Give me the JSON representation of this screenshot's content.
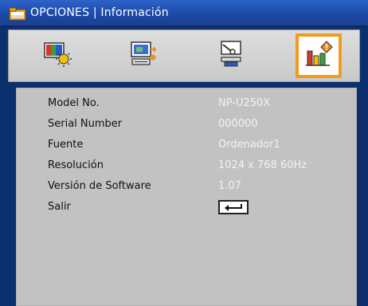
{
  "header": {
    "title": "OPCIONES | Información",
    "icon": "options-folder-icon"
  },
  "tabs": [
    {
      "name": "tab-image",
      "icon": "image-settings-icon",
      "selected": false
    },
    {
      "name": "tab-display",
      "icon": "screen-settings-icon",
      "selected": false
    },
    {
      "name": "tab-setup",
      "icon": "setup-tools-icon",
      "selected": false
    },
    {
      "name": "tab-information",
      "icon": "information-chart-icon",
      "selected": true
    }
  ],
  "info": {
    "rows": [
      {
        "label": "Model No.",
        "value": "NP-U250X"
      },
      {
        "label": "Serial Number",
        "value": "000000"
      },
      {
        "label": "Fuente",
        "value": "Ordenador1"
      },
      {
        "label": "Resolución",
        "value": "1024 x 768  60Hz"
      },
      {
        "label": "Versión de Software",
        "value": "1.07"
      }
    ],
    "exit_label": "Salir",
    "exit_icon": "enter-return-icon"
  },
  "colors": {
    "titlebar": "#1b4aa7",
    "selected_tab_border": "#f29b1d",
    "content_bg": "#c2c2c2",
    "value_text": "#f3f3f3"
  }
}
